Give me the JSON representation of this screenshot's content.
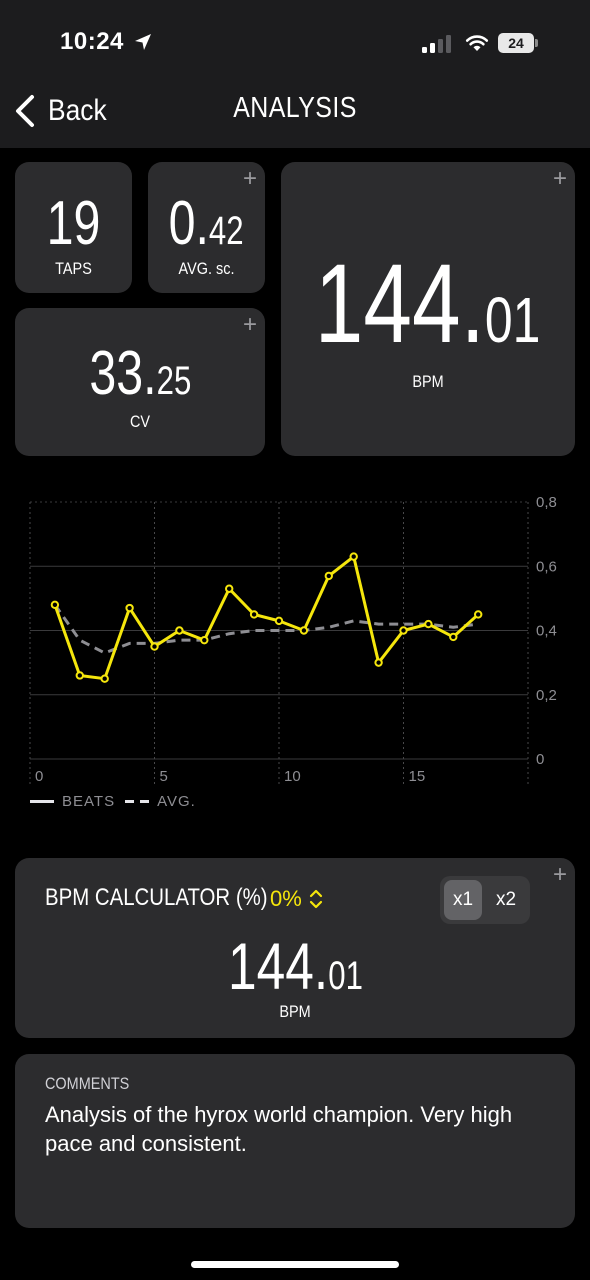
{
  "status_bar": {
    "time": "10:24",
    "battery": "24"
  },
  "nav": {
    "back_label": "Back",
    "title": "ANALYSIS"
  },
  "stats": {
    "taps": {
      "value": "19",
      "label": "TAPS"
    },
    "avg_sc": {
      "int": "0.",
      "dec": "42",
      "label": "AVG. sc."
    },
    "cv": {
      "int": "33.",
      "dec": "25",
      "label": "CV"
    },
    "bpm": {
      "int": "144.",
      "dec": "01",
      "label": "BPM"
    }
  },
  "chart_data": {
    "type": "line",
    "x": [
      1,
      2,
      3,
      4,
      5,
      6,
      7,
      8,
      9,
      10,
      11,
      12,
      13,
      14,
      15,
      16,
      17,
      18
    ],
    "series": [
      {
        "name": "BEATS",
        "color": "#f5e60c",
        "values": [
          0.48,
          0.26,
          0.25,
          0.47,
          0.35,
          0.4,
          0.37,
          0.53,
          0.45,
          0.43,
          0.4,
          0.57,
          0.63,
          0.3,
          0.4,
          0.42,
          0.38,
          0.45
        ]
      },
      {
        "name": "AVG.",
        "color": "#8e8e93",
        "values": [
          0.48,
          0.37,
          0.33,
          0.36,
          0.36,
          0.37,
          0.37,
          0.39,
          0.4,
          0.4,
          0.4,
          0.41,
          0.43,
          0.42,
          0.42,
          0.42,
          0.41,
          0.42
        ]
      }
    ],
    "xlim": [
      0,
      20
    ],
    "ylim": [
      0,
      0.8
    ],
    "x_ticks": [
      "0",
      "5",
      "10",
      "15"
    ],
    "y_ticks": [
      "0",
      "0,2",
      "0,4",
      "0,6",
      "0,8"
    ],
    "y_axis_side": "right",
    "grid": true,
    "legend": "bottom-left"
  },
  "calculator": {
    "title": "BPM CALCULATOR (%)",
    "percent": "0%",
    "options": [
      "x1",
      "x2"
    ],
    "selected": "x1",
    "bpm_int": "144.",
    "bpm_dec": "01",
    "bpm_label": "BPM"
  },
  "comments": {
    "heading": "COMMENTS",
    "text": "Analysis of the hyrox world champion. Very high pace and consistent."
  },
  "plus_symbol": "+"
}
